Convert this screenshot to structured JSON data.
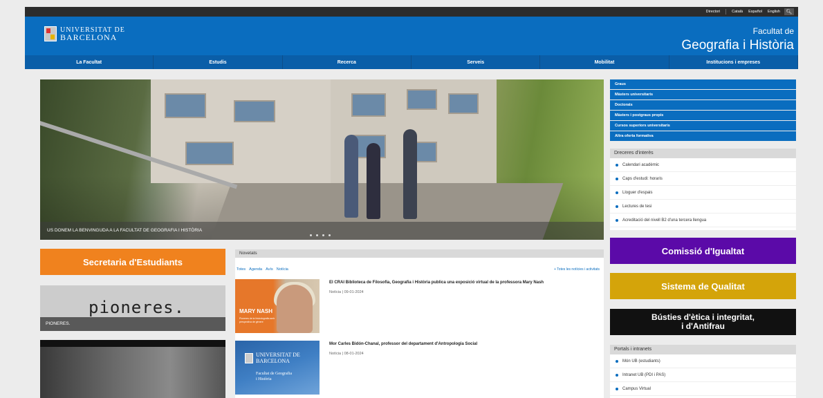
{
  "topbar": {
    "links": [
      "Directori",
      "Català",
      "Español",
      "English"
    ],
    "search_icon": "search-icon"
  },
  "header": {
    "logo_line1": "UNIVERSITAT DE",
    "logo_line2": "BARCELONA",
    "faculty_line1": "Facultat de",
    "faculty_line2": "Geografia i Història"
  },
  "nav": [
    "La Facultat",
    "Estudis",
    "Recerca",
    "Serveis",
    "Mobilitat",
    "Institucions i empreses"
  ],
  "hero": {
    "caption": "US DONEM LA BENVINGUDA A LA FACULTAT DE GEOGRAFIA I HISTÒRIA"
  },
  "side_links": [
    "Graus",
    "Màsters universitaris",
    "Doctorats",
    "Màsters i postgraus propis",
    "Cursos superiors universitaris",
    "Altra oferta formativa"
  ],
  "dreceres": {
    "title": "Dreceres d'interès",
    "items": [
      "Calendari acadèmic",
      "Caps d'estudi: horaris",
      "Lloguer d'espais",
      "Lectures de tesi",
      "Acreditació del nivell B2 d'una tercera llengua"
    ]
  },
  "banners": {
    "igualtat": "Comissió d'Igualtat",
    "qualitat": "Sistema de Qualitat",
    "bustie_line1": "Bústies d'ètica i integritat,",
    "bustie_line2": "i d'Antifrau"
  },
  "portals": {
    "title": "Portals i intranets",
    "items": [
      "Món UB (estudiants)",
      "Intranet UB (PDI i PAS)",
      "Campus Virtual"
    ]
  },
  "secretaria": "Secretaria d'Estudiants",
  "pioneres": {
    "word": "pioneres.",
    "caption": "PIONERES."
  },
  "news": {
    "title": "Novetats",
    "tabs": [
      "Totes",
      "Agenda",
      "Avís",
      "Notícia"
    ],
    "all_link": "+ Totes les notícies i activitats",
    "items": [
      {
        "title": "El CRAI Biblioteca de Filosofia, Geografia i Història publica una exposició virtual de la professora Mary Nash",
        "meta": "Notícia | 09-01-2024",
        "thumb_name": "MARY NASH",
        "thumb_sub": "Pioneres de la historiografia amb perspectiva de gènere"
      },
      {
        "title": "Mor Carles Bidón-Chanal, professor del departament d'Antropologia Social",
        "meta": "Notícia | 08-01-2024",
        "thumb_l1": "UNIVERSITAT DE",
        "thumb_l2": "BARCELONA",
        "thumb_f1": "Facultat de Geografia",
        "thumb_f2": "i Història"
      }
    ]
  },
  "colors": {
    "brand_blue": "#0a6dbf",
    "orange": "#f0821e",
    "purple": "#5b0aa8",
    "gold": "#d4a40a",
    "black": "#111111"
  }
}
